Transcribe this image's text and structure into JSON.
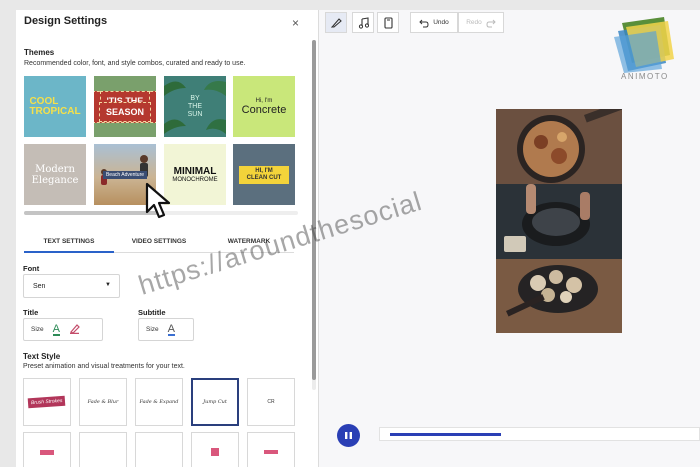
{
  "panel": {
    "title": "Design Settings",
    "close_icon": "×"
  },
  "themes": {
    "title": "Themes",
    "description": "Recommended color, font, and style combos, curated and ready to use.",
    "items": [
      {
        "lines": [
          "COOL",
          "TROPICAL"
        ]
      },
      {
        "lines": [
          "'TIS THE",
          "SEASON"
        ]
      },
      {
        "lines": [
          "BY",
          "THE",
          "SUN"
        ]
      },
      {
        "prefix": "Hi, I'm",
        "lines": [
          "Concrete"
        ]
      },
      {
        "lines": [
          "Modern",
          "Elegance"
        ]
      },
      {
        "lines": [
          "Beach Adventure"
        ]
      },
      {
        "lines": [
          "MINIMAL",
          "MONOCHROME"
        ]
      },
      {
        "lines": [
          "HI, I'M",
          "CLEAN CUT"
        ]
      }
    ]
  },
  "tabs": [
    {
      "label": "TEXT SETTINGS",
      "active": true
    },
    {
      "label": "VIDEO SETTINGS",
      "active": false
    },
    {
      "label": "WATERMARK",
      "active": false
    }
  ],
  "font": {
    "label": "Font",
    "value": "Sen"
  },
  "title_field": {
    "label": "Title",
    "size_label": "Size",
    "underline_color": "#2e8b57",
    "pen_color": "#c44c6a"
  },
  "subtitle_field": {
    "label": "Subtitle",
    "size_label": "Size",
    "underline_color": "#3b6fd1"
  },
  "text_style": {
    "title": "Text Style",
    "description": "Preset animation and visual treatments for your text.",
    "options": [
      {
        "label": "Brush Strokes",
        "kind": "brush"
      },
      {
        "label": "Fade & Blur",
        "kind": "script"
      },
      {
        "label": "Fade & Expand",
        "kind": "script"
      },
      {
        "label": "Jump Cut",
        "kind": "script",
        "selected": true
      },
      {
        "label": "CR",
        "kind": "plain"
      }
    ]
  },
  "toolbar": {
    "undo_label": "Undo",
    "redo_label": "Redo",
    "icons": [
      "pencil-icon",
      "music-note-icon",
      "phone-icon",
      "undo-icon",
      "redo-icon"
    ]
  },
  "brand": {
    "name": "ANIMOTO"
  },
  "player": {
    "state": "playing",
    "progress": 0.37
  },
  "watermark_text": "https://aroundthesocial",
  "colors": {
    "accent": "#2a3fb5",
    "tab_underline": "#2a62c9"
  }
}
